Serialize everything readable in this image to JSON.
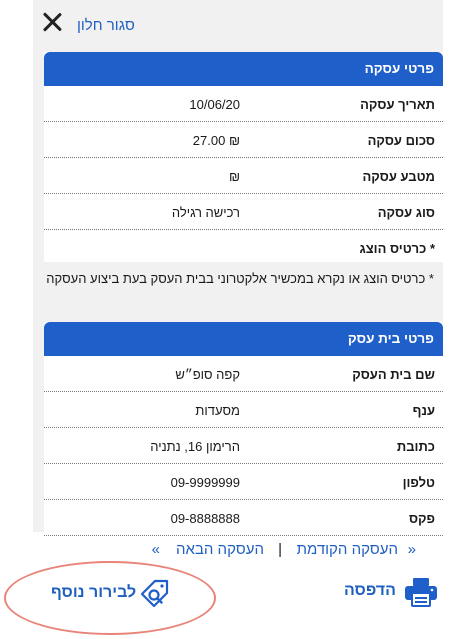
{
  "top": {
    "close_label": "סגור חלון"
  },
  "transaction": {
    "header": "פרטי עסקה",
    "rows": [
      {
        "label": "תאריך עסקה",
        "value": "10/06/20"
      },
      {
        "label": "סכום עסקה",
        "value": "₪ 27.00"
      },
      {
        "label": "מטבע עסקה",
        "value": "₪"
      },
      {
        "label": "סוג עסקה",
        "value": "רכישה רגילה"
      },
      {
        "label": "* כרטיס הוצג",
        "value": ""
      }
    ],
    "note": "* כרטיס הוצג או נקרא במכשיר אלקטרוני בבית העסק בעת ביצוע העסקה"
  },
  "merchant": {
    "header": "פרטי בית עסק",
    "rows": [
      {
        "label": "שם בית העסק",
        "value": "קפה סופ״ש"
      },
      {
        "label": "ענף",
        "value": "מסעדות"
      },
      {
        "label": "כתובת",
        "value": "הרימון 16, נתניה"
      },
      {
        "label": "טלפון",
        "value": "09-9999999"
      },
      {
        "label": "פקס",
        "value": "09-8888888"
      }
    ]
  },
  "nav": {
    "prev_arrow": "«",
    "prev_label": "העסקה הקודמת",
    "separator": "|",
    "next_label": "העסקה הבאה",
    "next_arrow": "»"
  },
  "actions": {
    "print_label": "הדפסה",
    "print_icon": "printer-icon",
    "inquiry_label": "לבירור נוסף",
    "inquiry_icon": "tag-search-icon",
    "highlight_color": "#e8847a"
  },
  "colors": {
    "accent": "#1f5fc9",
    "link": "#1f5fbf",
    "panel": "#f1f1f1"
  }
}
